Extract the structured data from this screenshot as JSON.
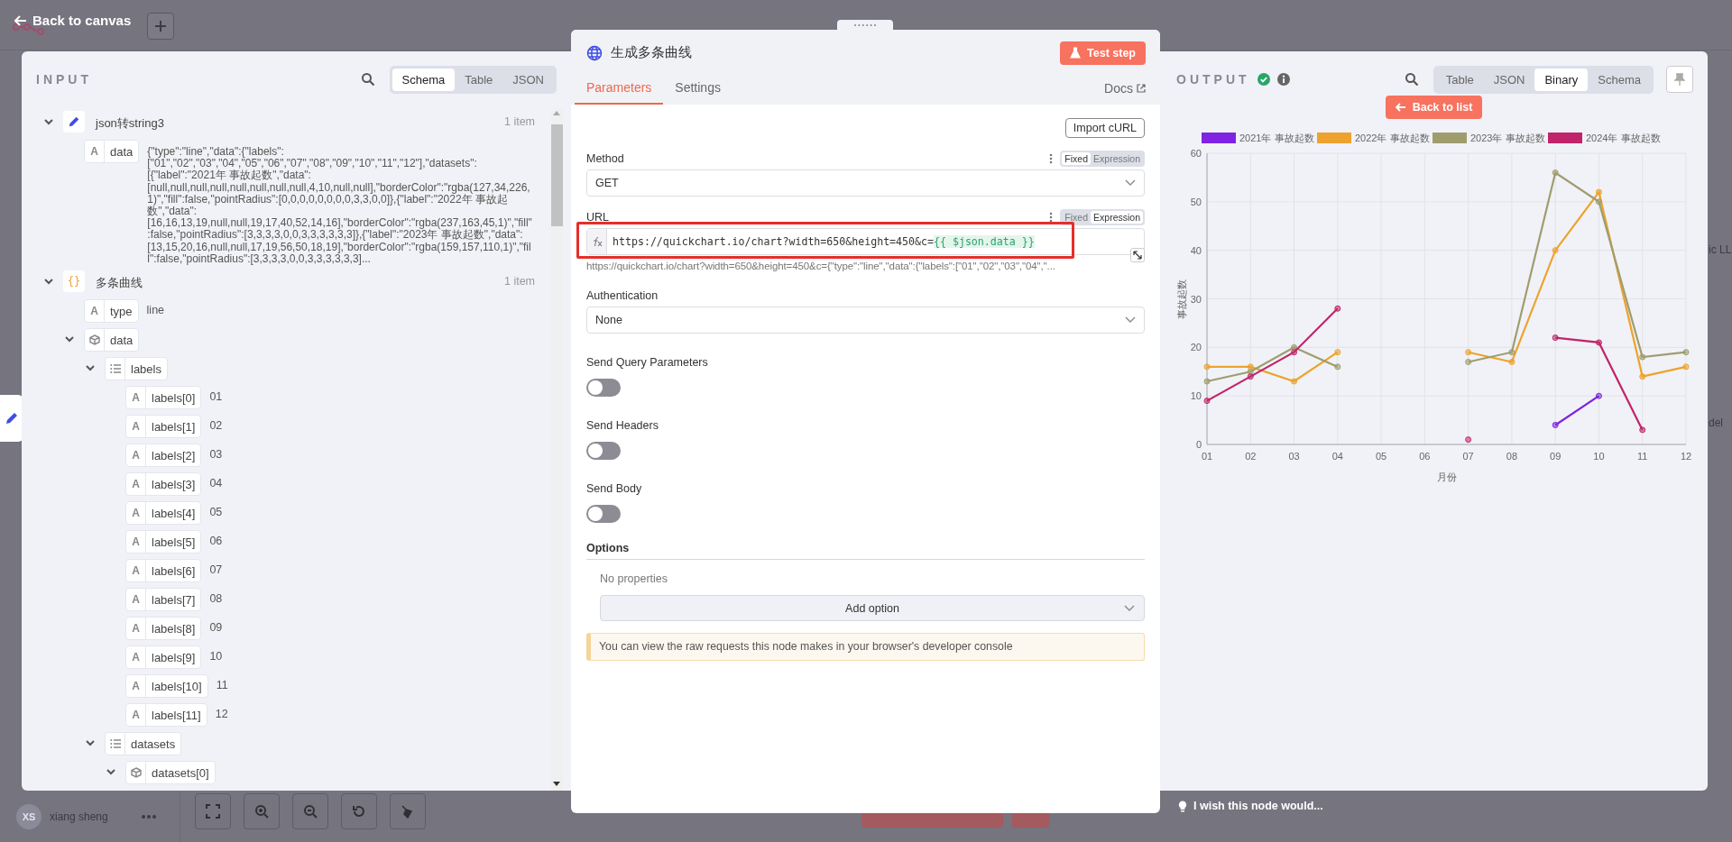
{
  "top_bar": {
    "back_label": "Back to canvas"
  },
  "input": {
    "title": "INPUT",
    "view_tabs": [
      {
        "label": "Schema",
        "selected": true
      },
      {
        "label": "Table",
        "selected": false
      },
      {
        "label": "JSON",
        "selected": false
      }
    ],
    "tree": [
      {
        "kind": "edit",
        "name": "json转string3",
        "count": "1 item",
        "expanded": true,
        "children": [
          {
            "kind": "string",
            "glyph": "A",
            "name": "data",
            "value": "{\"type\":\"line\",\"data\":{\"labels\":[\"01\",\"02\",\"03\",\"04\",\"05\",\"06\",\"07\",\"08\",\"09\",\"10\",\"11\",\"12\"],\"datasets\":[{\"label\":\"2021年 事故起数\",\"data\":[null,null,null,null,null,null,null,null,4,10,null,null],\"borderColor\":\"rgba(127,34,226,1)\",\"fill\":false,\"pointRadius\":[0,0,0,0,0,0,0,0,3,3,0,0]},{\"label\":\"2022年 事故起数\",\"data\":[16,16,13,19,null,null,19,17,40,52,14,16],\"borderColor\":\"rgba(237,163,45,1)\",\"fill\":false,\"pointRadius\":[3,3,3,3,0,0,3,3,3,3,3,3]},{\"label\":\"2023年 事故起数\",\"data\":[13,15,20,16,null,null,17,19,56,50,18,19],\"borderColor\":\"rgba(159,157,110,1)\",\"fill\":false,\"pointRadius\":[3,3,3,3,0,0,3,3,3,3,3,3]..."
          }
        ]
      },
      {
        "kind": "group",
        "glyph": "{}",
        "name": "多条曲线",
        "count": "1 item",
        "expanded": true,
        "children": [
          {
            "kind": "string",
            "glyph": "A",
            "name": "type",
            "value": "line"
          },
          {
            "kind": "object",
            "name": "data",
            "expanded": true,
            "children": [
              {
                "kind": "array",
                "name": "labels",
                "expanded": true,
                "children": [
                  {
                    "kind": "string",
                    "glyph": "A",
                    "name": "labels[0]",
                    "value": "01"
                  },
                  {
                    "kind": "string",
                    "glyph": "A",
                    "name": "labels[1]",
                    "value": "02"
                  },
                  {
                    "kind": "string",
                    "glyph": "A",
                    "name": "labels[2]",
                    "value": "03"
                  },
                  {
                    "kind": "string",
                    "glyph": "A",
                    "name": "labels[3]",
                    "value": "04"
                  },
                  {
                    "kind": "string",
                    "glyph": "A",
                    "name": "labels[4]",
                    "value": "05"
                  },
                  {
                    "kind": "string",
                    "glyph": "A",
                    "name": "labels[5]",
                    "value": "06"
                  },
                  {
                    "kind": "string",
                    "glyph": "A",
                    "name": "labels[6]",
                    "value": "07"
                  },
                  {
                    "kind": "string",
                    "glyph": "A",
                    "name": "labels[7]",
                    "value": "08"
                  },
                  {
                    "kind": "string",
                    "glyph": "A",
                    "name": "labels[8]",
                    "value": "09"
                  },
                  {
                    "kind": "string",
                    "glyph": "A",
                    "name": "labels[9]",
                    "value": "10"
                  },
                  {
                    "kind": "string",
                    "glyph": "A",
                    "name": "labels[10]",
                    "value": "11"
                  },
                  {
                    "kind": "string",
                    "glyph": "A",
                    "name": "labels[11]",
                    "value": "12"
                  }
                ]
              },
              {
                "kind": "array",
                "name": "datasets",
                "expanded": true,
                "children": [
                  {
                    "kind": "object",
                    "name": "datasets[0]",
                    "expanded": true
                  }
                ]
              }
            ]
          }
        ]
      }
    ]
  },
  "node": {
    "title": "生成多条曲线",
    "test_button": "Test step",
    "tabs": [
      {
        "label": "Parameters",
        "selected": true
      },
      {
        "label": "Settings",
        "selected": false
      }
    ],
    "docs_link": "Docs",
    "import_button": "Import cURL",
    "params": [
      {
        "kind": "select",
        "label": "Method",
        "modes": [
          {
            "label": "Fixed",
            "selected": true
          },
          {
            "label": "Expression",
            "selected": false
          }
        ],
        "value": "GET"
      },
      {
        "kind": "expression",
        "label": "URL",
        "modes": [
          {
            "label": "Fixed",
            "selected": false
          },
          {
            "label": "Expression",
            "selected": true
          }
        ],
        "value": "https://quickchart.io/chart?width=650&height=450&c=",
        "expression": "{{ $json.data }}",
        "preview": "https://quickchart.io/chart?width=650&height=450&c={\"type\":\"line\",\"data\":{\"labels\":[\"01\",\"02\",\"03\",\"04\",\"...",
        "highlighted": true
      },
      {
        "kind": "select",
        "label": "Authentication",
        "value": "None"
      },
      {
        "kind": "toggle",
        "label": "Send Query Parameters",
        "on": false
      },
      {
        "kind": "toggle",
        "label": "Send Headers",
        "on": false
      },
      {
        "kind": "toggle",
        "label": "Send Body",
        "on": false
      }
    ],
    "options": {
      "label": "Options",
      "empty_text": "No properties",
      "add_button": "Add option"
    },
    "notice": "You can view the raw requests this node makes in your browser's developer console"
  },
  "output": {
    "title": "OUTPUT",
    "view_tabs": [
      {
        "label": "Table",
        "selected": false
      },
      {
        "label": "JSON",
        "selected": false
      },
      {
        "label": "Binary",
        "selected": true
      },
      {
        "label": "Schema",
        "selected": false
      }
    ],
    "back_button": "Back to list",
    "chart_data": {
      "type": "line",
      "xlabel": "月份",
      "ylabel": "事故起数",
      "categories": [
        "01",
        "02",
        "03",
        "04",
        "05",
        "06",
        "07",
        "08",
        "09",
        "10",
        "11",
        "12"
      ],
      "series": [
        {
          "name": "2021年 事故起数",
          "color": "#7f22e2",
          "marker": "circle",
          "values": [
            null,
            null,
            null,
            null,
            null,
            null,
            null,
            null,
            4,
            10,
            null,
            null
          ]
        },
        {
          "name": "2022年 事故起数",
          "color": "#eda32d",
          "marker": "circle",
          "values": [
            16,
            16,
            13,
            19,
            null,
            null,
            19,
            17,
            40,
            52,
            14,
            16
          ]
        },
        {
          "name": "2023年 事故起数",
          "color": "#9f9d6e",
          "marker": "circle",
          "values": [
            13,
            15,
            20,
            16,
            null,
            null,
            17,
            19,
            56,
            50,
            18,
            19
          ]
        },
        {
          "name": "2024年 事故起数",
          "color": "#c0246a",
          "marker": "circle",
          "values": [
            9,
            14,
            19,
            28,
            null,
            null,
            1,
            null,
            22,
            21,
            3,
            null
          ]
        }
      ],
      "ylim": [
        0,
        60
      ],
      "yticks": [
        0,
        10,
        20,
        30,
        40,
        50,
        60
      ],
      "grid": true,
      "legend": true
    }
  },
  "footer": {
    "user_initials": "XS",
    "user_name": "xiang sheng",
    "feedback": "I wish this node would..."
  },
  "canvas_fragments": [
    "ic LL",
    "del"
  ]
}
